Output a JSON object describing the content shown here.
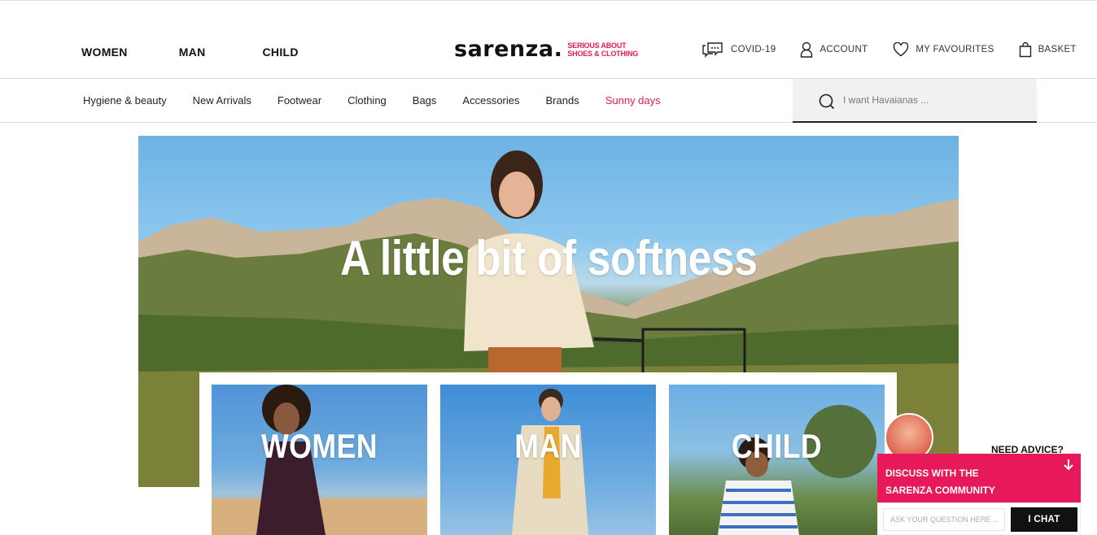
{
  "header": {
    "gender_nav": [
      "WOMEN",
      "MAN",
      "CHILD"
    ],
    "logo": {
      "wordmark": "sarenza.",
      "tagline_line1": "SERIOUS ABOUT",
      "tagline_line2": "SHOES & CLOTHING"
    },
    "utilities": {
      "covid": "COVID-19",
      "account": "ACCOUNT",
      "favourites": "MY FAVOURITES",
      "basket": "BASKET"
    }
  },
  "category_nav": {
    "items": [
      "Hygiene & beauty",
      "New Arrivals",
      "Footwear",
      "Clothing",
      "Bags",
      "Accessories",
      "Brands",
      "Sunny days"
    ]
  },
  "search": {
    "placeholder": "I want Havaianas ..."
  },
  "hero": {
    "title": "A little bit of softness"
  },
  "categories": [
    {
      "label": "WOMEN"
    },
    {
      "label": "MAN"
    },
    {
      "label": "CHILD"
    }
  ],
  "chat": {
    "advice": "NEED ADVICE?",
    "headline_line1": "DISCUSS WITH THE",
    "headline_line2": "SARENZA COMMUNITY",
    "input_placeholder": "ASK YOUR QUESTION HERE ...",
    "button": "I CHAT"
  },
  "colors": {
    "brand_pink": "#e8195a",
    "text_dark": "#111111",
    "search_bg": "#f1f1f1"
  }
}
